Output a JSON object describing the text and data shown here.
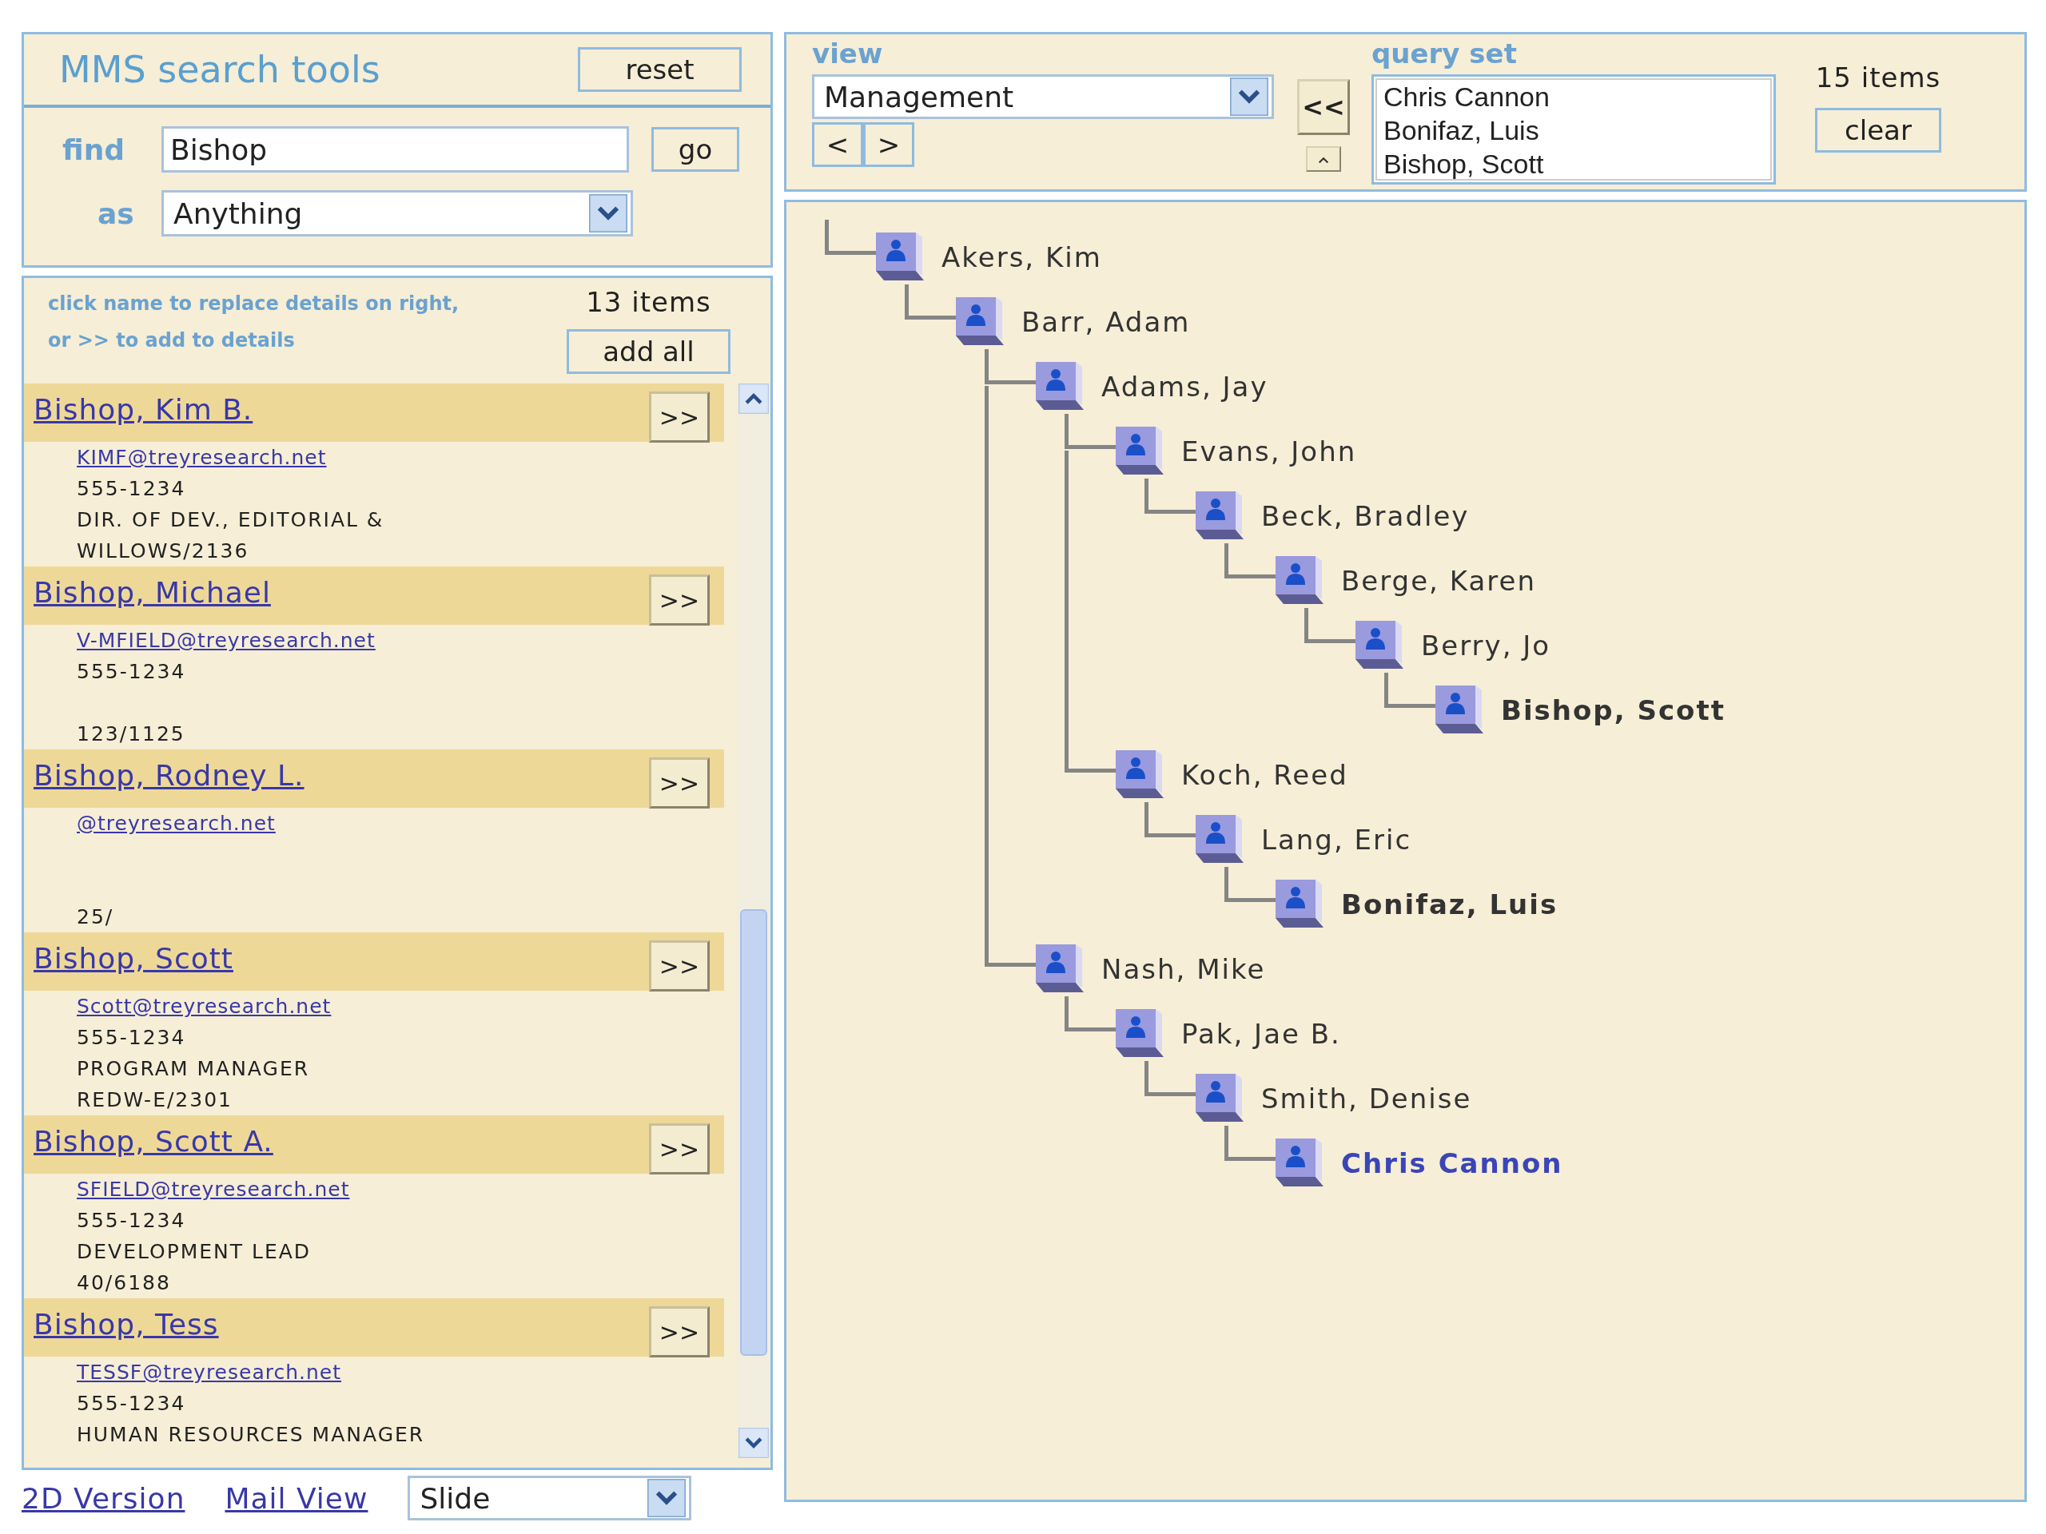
{
  "search_tools": {
    "title": "MMS search tools",
    "reset_button": "reset",
    "find_label": "find",
    "find_value": "Bishop",
    "go_button": "go",
    "as_label": "as",
    "as_value": "Anything"
  },
  "results": {
    "instructions": [
      "click name to replace details on right,",
      "or >> to add to details"
    ],
    "count": "13 items",
    "add_all_button": "add all",
    "entries": [
      {
        "name": "Bishop, Kim B.",
        "email": "KIMF@treyresearch.net",
        "phone": "555-1234",
        "title": "DIR. OF DEV., EDITORIAL &",
        "office": "WILLOWS/2136",
        "add_button": ">>"
      },
      {
        "name": "Bishop, Michael",
        "email": "V-MFIELD@treyresearch.net",
        "phone": "555-1234",
        "office": "123/1125",
        "add_button": ">>"
      },
      {
        "name": "Bishop, Rodney L.",
        "email": "@treyresearch.net",
        "office": "25/",
        "add_button": ">>"
      },
      {
        "name": "Bishop, Scott",
        "email": "Scott@treyresearch.net",
        "phone": "555-1234",
        "title": "PROGRAM MANAGER",
        "office": "REDW-E/2301",
        "add_button": ">>"
      },
      {
        "name": "Bishop, Scott A.",
        "email": "SFIELD@treyresearch.net",
        "phone": "555-1234",
        "title": "DEVELOPMENT LEAD",
        "office": "40/6188",
        "add_button": ">>"
      },
      {
        "name": "Bishop, Tess",
        "email": "TESSF@treyresearch.net",
        "phone": "555-1234",
        "title": "HUMAN RESOURCES MANAGER",
        "add_button": ">>"
      }
    ]
  },
  "footer": {
    "links": [
      "2D Version",
      "Mail View"
    ],
    "dropdown": "Slide"
  },
  "view_panel": {
    "view_label": "view",
    "view_value": "Management",
    "prev_button": "<",
    "next_button": ">",
    "add_back_button": "<<",
    "query_label": "query set",
    "query_items": [
      "Chris Cannon",
      "Bonifaz, Luis",
      "Bishop, Scott"
    ],
    "count": "15 items",
    "clear_button": "clear"
  },
  "tree": [
    {
      "name": "Akers, Kim",
      "highlighted": false,
      "selected": false,
      "children": [
        {
          "name": "Barr, Adam",
          "highlighted": false,
          "selected": false,
          "children": [
            {
              "name": "Adams, Jay",
              "highlighted": false,
              "selected": false,
              "children": [
                {
                  "name": "Evans, John",
                  "highlighted": false,
                  "selected": false,
                  "children": [
                    {
                      "name": "Beck, Bradley",
                      "highlighted": false,
                      "selected": false,
                      "children": [
                        {
                          "name": "Berge, Karen",
                          "highlighted": false,
                          "selected": false,
                          "children": [
                            {
                              "name": "Berry, Jo",
                              "highlighted": false,
                              "selected": false,
                              "children": [
                                {
                                  "name": "Bishop, Scott",
                                  "highlighted": true,
                                  "selected": false
                                }
                              ]
                            }
                          ]
                        }
                      ]
                    }
                  ]
                },
                {
                  "name": "Koch, Reed",
                  "highlighted": false,
                  "selected": false,
                  "children": [
                    {
                      "name": "Lang, Eric",
                      "highlighted": false,
                      "selected": false,
                      "children": [
                        {
                          "name": "Bonifaz, Luis",
                          "highlighted": true,
                          "selected": false
                        }
                      ]
                    }
                  ]
                }
              ]
            },
            {
              "name": "Nash, Mike",
              "highlighted": false,
              "selected": false,
              "children": [
                {
                  "name": "Pak, Jae B.",
                  "highlighted": false,
                  "selected": false,
                  "children": [
                    {
                      "name": "Smith, Denise",
                      "highlighted": false,
                      "selected": false,
                      "children": [
                        {
                          "name": "Chris Cannon",
                          "highlighted": true,
                          "selected": true
                        }
                      ]
                    }
                  ]
                }
              ]
            }
          ]
        }
      ]
    }
  ]
}
